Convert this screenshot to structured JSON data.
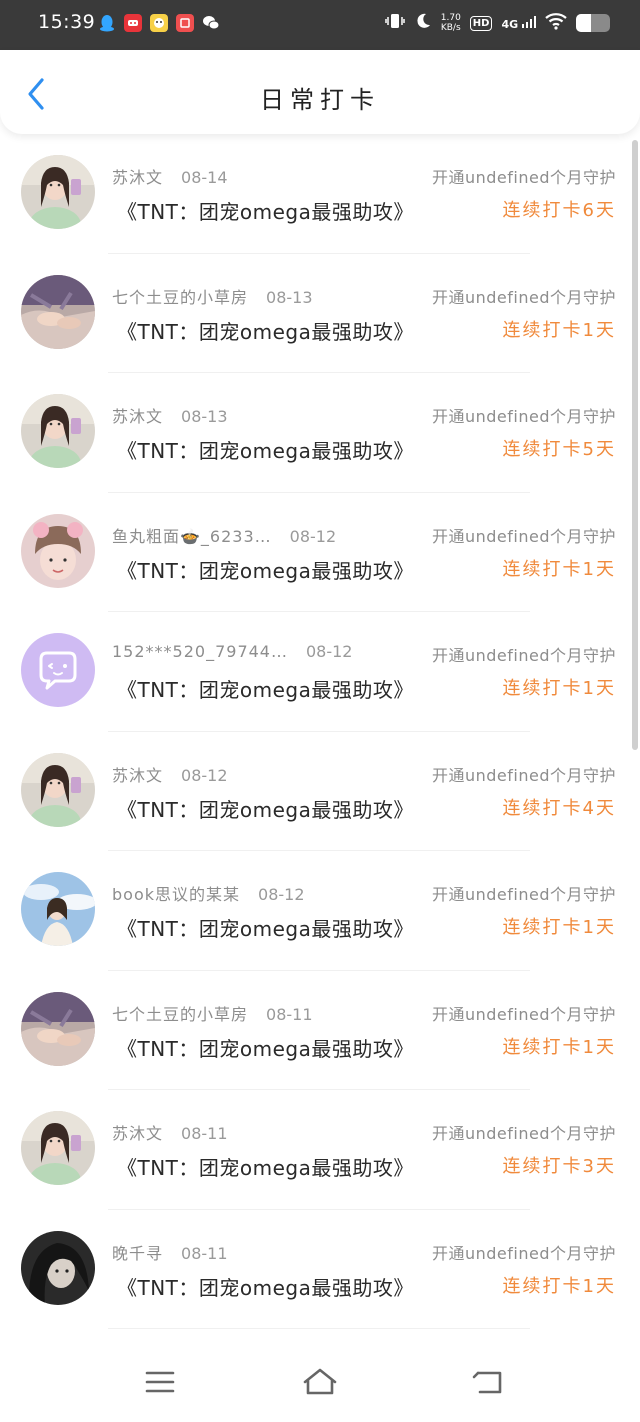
{
  "status_bar": {
    "time": "15:39",
    "network_speed_value": "1.70",
    "network_speed_unit": "KB/s",
    "hd_label": "HD",
    "signal_label": "4G",
    "battery_level": 0.45,
    "notification_icons": [
      "qq-icon",
      "red-app-icon",
      "yellow-app-icon",
      "red-square-app-icon",
      "wechat-icon"
    ],
    "system_icons": [
      "vibrate-icon",
      "moon-icon",
      "wifi-icon",
      "battery-icon"
    ]
  },
  "header": {
    "title": "日常打卡",
    "back_icon": "chevron-left-icon",
    "accent_color": "#2f8ff0"
  },
  "feed": [
    {
      "name": "苏沐文",
      "date": "08-14",
      "title": "《TNT：团宠omega最强助攻》",
      "guard": "开通undefined个月守护",
      "streak": "连续打卡6天",
      "avatar": "girl-selfie"
    },
    {
      "name": "七个土豆的小草房",
      "date": "08-13",
      "title": "《TNT：团宠omega最强助攻》",
      "guard": "开通undefined个月守护",
      "streak": "连续打卡1天",
      "avatar": "hands"
    },
    {
      "name": "苏沐文",
      "date": "08-13",
      "title": "《TNT：团宠omega最强助攻》",
      "guard": "开通undefined个月守护",
      "streak": "连续打卡5天",
      "avatar": "girl-selfie"
    },
    {
      "name": "鱼丸粗面🍲_6233…",
      "date": "08-12",
      "title": "《TNT：团宠omega最强助攻》",
      "guard": "开通undefined个月守护",
      "streak": "连续打卡1天",
      "avatar": "girl-hat"
    },
    {
      "name": "152***520_79744…",
      "date": "08-12",
      "title": "《TNT：团宠omega最强助攻》",
      "guard": "开通undefined个月守护",
      "streak": "连续打卡1天",
      "avatar": "default-chat"
    },
    {
      "name": "苏沐文",
      "date": "08-12",
      "title": "《TNT：团宠omega最强助攻》",
      "guard": "开通undefined个月守护",
      "streak": "连续打卡4天",
      "avatar": "girl-selfie"
    },
    {
      "name": "book思议的某某",
      "date": "08-12",
      "title": "《TNT：团宠omega最强助攻》",
      "guard": "开通undefined个月守护",
      "streak": "连续打卡1天",
      "avatar": "sky-girl"
    },
    {
      "name": "七个土豆的小草房",
      "date": "08-11",
      "title": "《TNT：团宠omega最强助攻》",
      "guard": "开通undefined个月守护",
      "streak": "连续打卡1天",
      "avatar": "hands"
    },
    {
      "name": "苏沐文",
      "date": "08-11",
      "title": "《TNT：团宠omega最强助攻》",
      "guard": "开通undefined个月守护",
      "streak": "连续打卡3天",
      "avatar": "girl-selfie"
    },
    {
      "name": "晚千寻",
      "date": "08-11",
      "title": "《TNT：团宠omega最强助攻》",
      "guard": "开通undefined个月守护",
      "streak": "连续打卡1天",
      "avatar": "dark-hair"
    }
  ],
  "colors": {
    "streak": "#f08a3c",
    "muted_text": "#8d8d8d",
    "title_text": "#2a2a2a"
  },
  "nav_bar": {
    "icons": [
      "menu-icon",
      "home-icon",
      "back-nav-icon"
    ]
  }
}
